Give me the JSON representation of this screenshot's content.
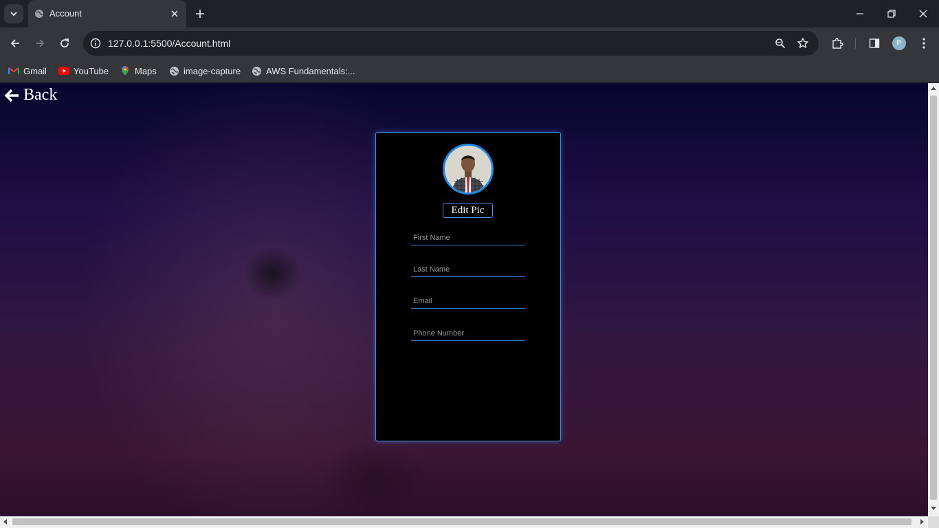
{
  "browser": {
    "tab_title": "Account",
    "url": "127.0.0.1:5500/Account.html",
    "profile_initial": "P"
  },
  "bookmarks": [
    {
      "label": "Gmail",
      "icon": "gmail-icon"
    },
    {
      "label": "YouTube",
      "icon": "youtube-icon"
    },
    {
      "label": "Maps",
      "icon": "maps-icon"
    },
    {
      "label": "image-capture",
      "icon": "globe-icon"
    },
    {
      "label": "AWS Fundamentals:...",
      "icon": "globe-icon"
    }
  ],
  "page": {
    "back_label": "Back",
    "edit_pic_label": "Edit Pic",
    "fields": {
      "first_name": "First Name",
      "last_name": "Last Name",
      "email": "Email",
      "phone": "Phone Number"
    }
  },
  "colors": {
    "accent": "#1e88e5",
    "card_bg": "#000000",
    "browser_dark": "#202124"
  }
}
